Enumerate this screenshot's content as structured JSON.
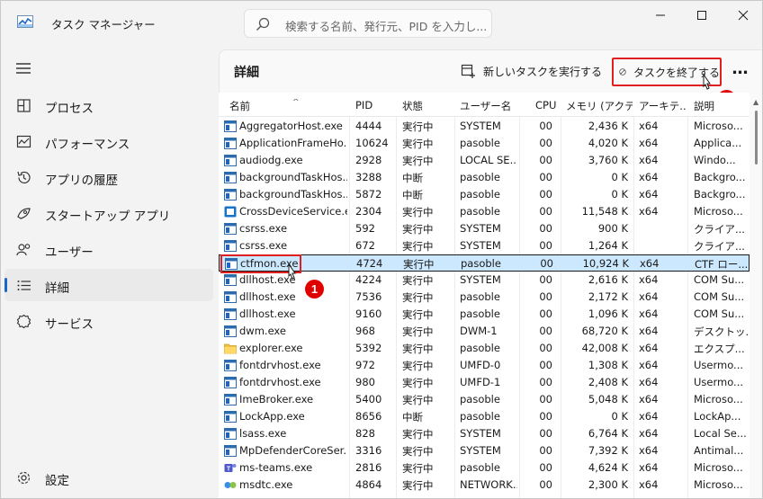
{
  "window": {
    "title": "タスク マネージャー",
    "search_placeholder": "検索する名前、発行元、PID を入力し..."
  },
  "sidebar": {
    "items": [
      {
        "label": "プロセス",
        "icon": "processes-icon",
        "active": false
      },
      {
        "label": "パフォーマンス",
        "icon": "performance-icon",
        "active": false
      },
      {
        "label": "アプリの履歴",
        "icon": "history-icon",
        "active": false
      },
      {
        "label": "スタートアップ アプリ",
        "icon": "startup-icon",
        "active": false
      },
      {
        "label": "ユーザー",
        "icon": "users-icon",
        "active": false
      },
      {
        "label": "詳細",
        "icon": "details-icon",
        "active": true
      },
      {
        "label": "サービス",
        "icon": "services-icon",
        "active": false
      }
    ],
    "settings_label": "設定"
  },
  "header": {
    "title": "詳細",
    "run_task_label": "新しいタスクを実行する",
    "end_task_label": "タスクを終了する",
    "more_label": "…"
  },
  "annotations": {
    "badge1": "1",
    "badge2": "2"
  },
  "table": {
    "columns": [
      "名前",
      "PID",
      "状態",
      "ユーザー名",
      "CPU",
      "メモリ (アクテ...",
      "アーキテ...",
      "説明"
    ],
    "selected_index": 8,
    "rows": [
      {
        "name": "AggregatorHost.exe",
        "pid": "4444",
        "status": "実行中",
        "user": "SYSTEM",
        "cpu": "00",
        "mem": "2,436 K",
        "arch": "x64",
        "desc": "Microso...",
        "icon": "app"
      },
      {
        "name": "ApplicationFrameHo...",
        "pid": "10624",
        "status": "実行中",
        "user": "pasoble",
        "cpu": "00",
        "mem": "4,020 K",
        "arch": "x64",
        "desc": "Applica...",
        "icon": "app"
      },
      {
        "name": "audiodg.exe",
        "pid": "2928",
        "status": "実行中",
        "user": "LOCAL SE...",
        "cpu": "00",
        "mem": "3,760 K",
        "arch": "x64",
        "desc": "Windo...",
        "icon": "app"
      },
      {
        "name": "backgroundTaskHos...",
        "pid": "3288",
        "status": "中断",
        "user": "pasoble",
        "cpu": "00",
        "mem": "0 K",
        "arch": "x64",
        "desc": "Backgro...",
        "icon": "app"
      },
      {
        "name": "backgroundTaskHos...",
        "pid": "5872",
        "status": "中断",
        "user": "pasoble",
        "cpu": "00",
        "mem": "0 K",
        "arch": "x64",
        "desc": "Backgro...",
        "icon": "app"
      },
      {
        "name": "CrossDeviceService.e...",
        "pid": "2304",
        "status": "実行中",
        "user": "pasoble",
        "cpu": "00",
        "mem": "11,548 K",
        "arch": "x64",
        "desc": "Microso...",
        "icon": "crossdevice"
      },
      {
        "name": "csrss.exe",
        "pid": "592",
        "status": "実行中",
        "user": "SYSTEM",
        "cpu": "00",
        "mem": "900 K",
        "arch": "",
        "desc": "クライア...",
        "icon": "app"
      },
      {
        "name": "csrss.exe",
        "pid": "672",
        "status": "実行中",
        "user": "SYSTEM",
        "cpu": "00",
        "mem": "1,264 K",
        "arch": "",
        "desc": "クライア...",
        "icon": "app"
      },
      {
        "name": "ctfmon.exe",
        "pid": "4724",
        "status": "実行中",
        "user": "pasoble",
        "cpu": "00",
        "mem": "10,924 K",
        "arch": "x64",
        "desc": "CTF ロー...",
        "icon": "app"
      },
      {
        "name": "dllhost.exe",
        "pid": "4224",
        "status": "実行中",
        "user": "SYSTEM",
        "cpu": "00",
        "mem": "2,616 K",
        "arch": "x64",
        "desc": "COM Su...",
        "icon": "app"
      },
      {
        "name": "dllhost.exe",
        "pid": "7536",
        "status": "実行中",
        "user": "pasoble",
        "cpu": "00",
        "mem": "2,172 K",
        "arch": "x64",
        "desc": "COM Su...",
        "icon": "app"
      },
      {
        "name": "dllhost.exe",
        "pid": "9160",
        "status": "実行中",
        "user": "pasoble",
        "cpu": "00",
        "mem": "1,096 K",
        "arch": "x64",
        "desc": "COM Su...",
        "icon": "app"
      },
      {
        "name": "dwm.exe",
        "pid": "968",
        "status": "実行中",
        "user": "DWM-1",
        "cpu": "00",
        "mem": "68,720 K",
        "arch": "x64",
        "desc": "デスクトッ...",
        "icon": "app"
      },
      {
        "name": "explorer.exe",
        "pid": "5392",
        "status": "実行中",
        "user": "pasoble",
        "cpu": "00",
        "mem": "42,008 K",
        "arch": "x64",
        "desc": "エクスプ...",
        "icon": "folder"
      },
      {
        "name": "fontdrvhost.exe",
        "pid": "972",
        "status": "実行中",
        "user": "UMFD-0",
        "cpu": "00",
        "mem": "1,308 K",
        "arch": "x64",
        "desc": "Usermo...",
        "icon": "app"
      },
      {
        "name": "fontdrvhost.exe",
        "pid": "980",
        "status": "実行中",
        "user": "UMFD-1",
        "cpu": "00",
        "mem": "2,408 K",
        "arch": "x64",
        "desc": "Usermo...",
        "icon": "app"
      },
      {
        "name": "ImeBroker.exe",
        "pid": "5400",
        "status": "実行中",
        "user": "pasoble",
        "cpu": "00",
        "mem": "5,048 K",
        "arch": "x64",
        "desc": "Microso...",
        "icon": "app"
      },
      {
        "name": "LockApp.exe",
        "pid": "8656",
        "status": "中断",
        "user": "pasoble",
        "cpu": "00",
        "mem": "0 K",
        "arch": "x64",
        "desc": "LockAp...",
        "icon": "app"
      },
      {
        "name": "lsass.exe",
        "pid": "828",
        "status": "実行中",
        "user": "SYSTEM",
        "cpu": "00",
        "mem": "6,764 K",
        "arch": "x64",
        "desc": "Local Se...",
        "icon": "app"
      },
      {
        "name": "MpDefenderCoreSer...",
        "pid": "3316",
        "status": "実行中",
        "user": "SYSTEM",
        "cpu": "00",
        "mem": "7,392 K",
        "arch": "x64",
        "desc": "Antimal...",
        "icon": "app"
      },
      {
        "name": "ms-teams.exe",
        "pid": "2816",
        "status": "実行中",
        "user": "pasoble",
        "cpu": "00",
        "mem": "4,624 K",
        "arch": "x64",
        "desc": "Microso...",
        "icon": "teams"
      },
      {
        "name": "msdtc.exe",
        "pid": "4864",
        "status": "実行中",
        "user": "NETWORK...",
        "cpu": "00",
        "mem": "2,300 K",
        "arch": "x64",
        "desc": "Microso...",
        "icon": "msdtc"
      }
    ]
  }
}
